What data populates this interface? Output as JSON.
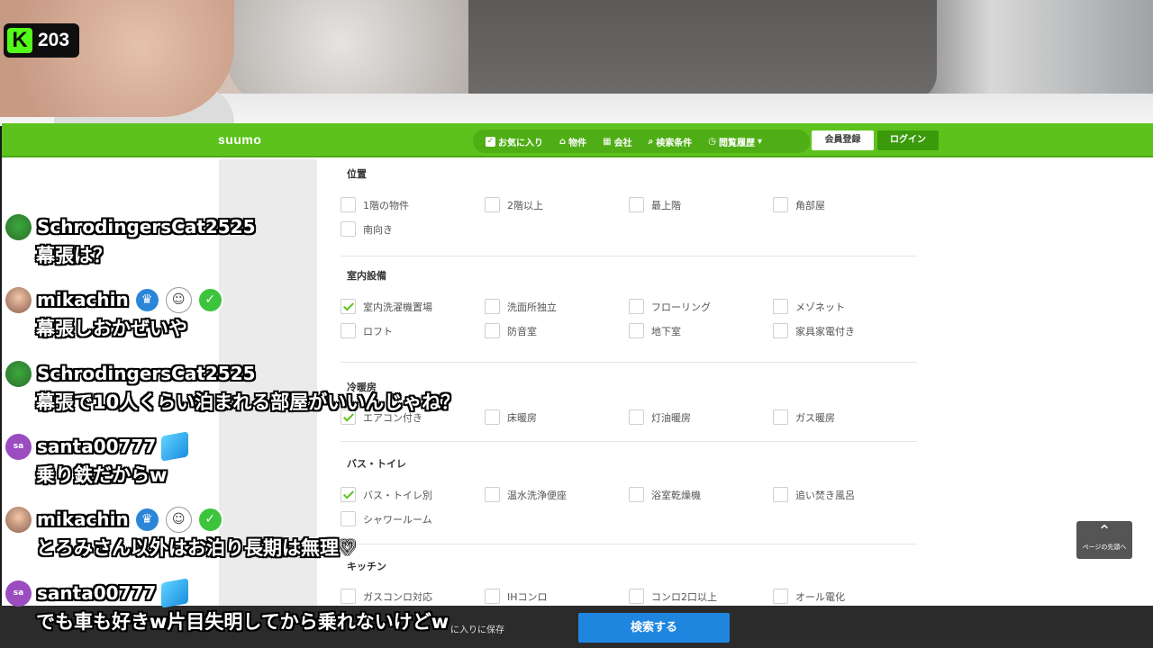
{
  "stream": {
    "platform_badge": "K",
    "viewer_count": "203"
  },
  "site": {
    "logo": "suumo",
    "nav": [
      {
        "label": "お気に入り",
        "icon": "checkbox-icon"
      },
      {
        "label": "物件",
        "icon": "home-icon"
      },
      {
        "label": "会社",
        "icon": "building-icon"
      },
      {
        "label": "検索条件",
        "icon": "search-icon"
      },
      {
        "label": "閲覧履歴",
        "icon": "clock-icon"
      }
    ],
    "register": "会員登録",
    "login": "ログイン"
  },
  "filters": {
    "position": {
      "title": "位置",
      "options": [
        {
          "label": "1階の物件",
          "checked": false
        },
        {
          "label": "2階以上",
          "checked": false
        },
        {
          "label": "最上階",
          "checked": false
        },
        {
          "label": "角部屋",
          "checked": false
        },
        {
          "label": "南向き",
          "checked": false
        }
      ]
    },
    "interior": {
      "title": "室内設備",
      "options": [
        {
          "label": "室内洗濯機置場",
          "checked": true
        },
        {
          "label": "洗面所独立",
          "checked": false
        },
        {
          "label": "フローリング",
          "checked": false
        },
        {
          "label": "メゾネット",
          "checked": false
        },
        {
          "label": "ロフト",
          "checked": false
        },
        {
          "label": "防音室",
          "checked": false
        },
        {
          "label": "地下室",
          "checked": false
        },
        {
          "label": "家具家電付き",
          "checked": false
        }
      ]
    },
    "aircon": {
      "title": "冷暖房",
      "options": [
        {
          "label": "エアコン付き",
          "checked": true
        },
        {
          "label": "床暖房",
          "checked": false
        },
        {
          "label": "灯油暖房",
          "checked": false
        },
        {
          "label": "ガス暖房",
          "checked": false
        }
      ]
    },
    "bath": {
      "title": "バス・トイレ",
      "options": [
        {
          "label": "バス・トイレ別",
          "checked": true
        },
        {
          "label": "温水洗浄便座",
          "checked": false
        },
        {
          "label": "浴室乾燥機",
          "checked": false
        },
        {
          "label": "追い焚き風呂",
          "checked": false
        },
        {
          "label": "シャワールーム",
          "checked": false
        }
      ]
    },
    "kitchen": {
      "title": "キッチン",
      "options": [
        {
          "label": "ガスコンロ対応",
          "checked": false
        },
        {
          "label": "IHコンロ",
          "checked": false
        },
        {
          "label": "コンロ2口以上",
          "checked": false
        },
        {
          "label": "オール電化",
          "checked": false
        }
      ]
    }
  },
  "page_top": "ページの先頭へ",
  "bottom": {
    "save_favorites": "に入りに保存",
    "search_button": "検索する"
  },
  "chat": [
    {
      "user": "SchrodingersCat2525",
      "text": "幕張は？",
      "avatar": "cat"
    },
    {
      "user": "mikachin",
      "text": "幕張しおかぜいや",
      "avatar": "girl"
    },
    {
      "user": "SchrodingersCat2525",
      "text": "幕張で10人くらい泊まれる部屋がいいんじゃね？",
      "avatar": "cat"
    },
    {
      "user": "santa00777",
      "text": "乗り鉄だからw",
      "avatar": "sa"
    },
    {
      "user": "mikachin",
      "text": "とろみさん以外はお泊り長期は無理♡",
      "avatar": "girl"
    },
    {
      "user": "santa00777",
      "text": "でも車も好きw片目失明してから乗れないけどw",
      "avatar": "sa"
    }
  ],
  "avatar_initials": "sa",
  "colors": {
    "suumo_green": "#5dc31c",
    "search_blue": "#1f86e0",
    "kick_green": "#53fc18"
  }
}
